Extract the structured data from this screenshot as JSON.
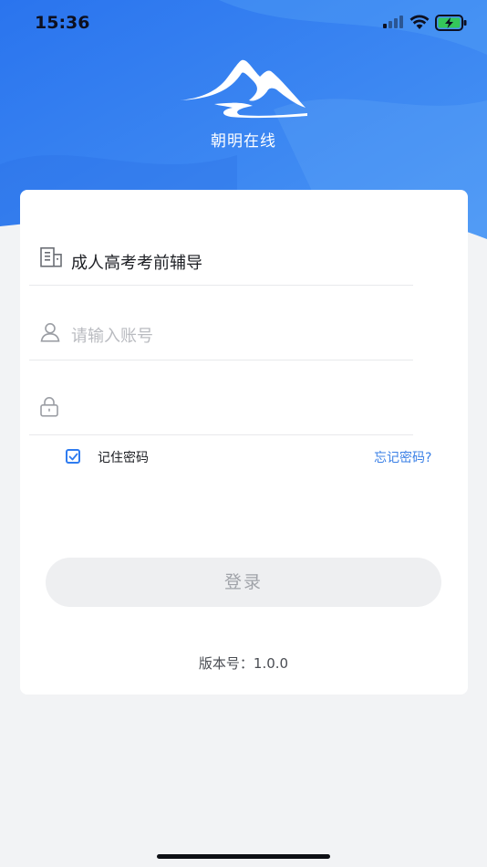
{
  "status_bar": {
    "time": "15:36",
    "signal_icon": "cellular-signal-icon",
    "wifi_icon": "wifi-icon",
    "battery_icon": "battery-charging-icon"
  },
  "header": {
    "logo_icon": "mountain-logo-icon",
    "app_name": "朝明在线"
  },
  "form": {
    "organization": {
      "icon": "building-icon",
      "label": "成人高考考前辅导"
    },
    "account": {
      "icon": "user-icon",
      "value": "",
      "placeholder": "请输入账号"
    },
    "password": {
      "icon": "lock-icon",
      "value": "",
      "placeholder": ""
    },
    "remember_password": {
      "label": "记住密码",
      "checked": true
    },
    "forgot_password": "忘记密码?",
    "login_button": "登录"
  },
  "footer": {
    "version_label": "版本号：",
    "version": "1.0.0"
  },
  "colors": {
    "brand_blue": "#2f7cf0",
    "link_blue": "#3b80e6",
    "page_background": "#f2f3f5"
  }
}
